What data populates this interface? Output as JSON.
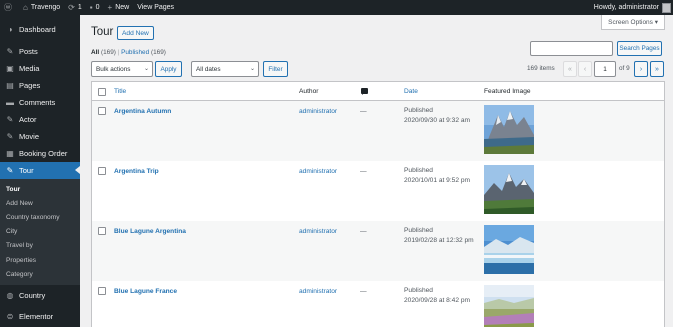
{
  "adminbar": {
    "site_name": "Travengo",
    "updates_count": "1",
    "comments_count": "0",
    "new_label": "New",
    "view_label": "View Pages",
    "howdy": "Howdy, administrator"
  },
  "sidebar": {
    "items": [
      {
        "label": "Dashboard",
        "icon": "dashboard-icon"
      },
      {
        "label": "Posts",
        "icon": "pin-icon"
      },
      {
        "label": "Media",
        "icon": "media-icon"
      },
      {
        "label": "Pages",
        "icon": "pages-icon"
      },
      {
        "label": "Comments",
        "icon": "comments-icon"
      },
      {
        "label": "Actor",
        "icon": "pin-icon"
      },
      {
        "label": "Movie",
        "icon": "pin-icon"
      },
      {
        "label": "Booking Order",
        "icon": "cart-icon"
      },
      {
        "label": "Tour",
        "icon": "pin-icon"
      }
    ],
    "submenu": [
      "Tour",
      "Add New",
      "Country taxonomy",
      "City",
      "Travel by",
      "Properties",
      "Category"
    ],
    "bottom": [
      {
        "label": "Country",
        "icon": "globe-icon"
      },
      {
        "label": "Elementor",
        "icon": "elementor-icon"
      }
    ]
  },
  "screen_options": "Screen Options ▾",
  "page": {
    "title": "Tour",
    "add_new": "Add New",
    "filter_all": "All",
    "filter_all_count": "(169)",
    "filter_published": "Published",
    "filter_published_count": "(169)",
    "search_button": "Search Pages"
  },
  "tablenav": {
    "bulk_actions": "Bulk actions",
    "apply": "Apply",
    "dates": "All dates",
    "filter": "Filter",
    "items": "169 items",
    "first": "«",
    "prev": "‹",
    "current_page": "1",
    "of_pages": "of 9",
    "next": "›",
    "last": "»"
  },
  "table": {
    "headers": {
      "title": "Title",
      "author": "Author",
      "date": "Date",
      "image": "Featured Image"
    },
    "rows": [
      {
        "title": "Argentina Autumn",
        "author": "administrator",
        "comments": "—",
        "status": "Published",
        "date": "2020/09/30 at 9:32 am"
      },
      {
        "title": "Argentina Trip",
        "author": "administrator",
        "comments": "—",
        "status": "Published",
        "date": "2020/10/01 at 9:52 pm"
      },
      {
        "title": "Blue Lagune Argentina",
        "author": "administrator",
        "comments": "—",
        "status": "Published",
        "date": "2019/02/28 at 12:32 pm"
      },
      {
        "title": "Blue Lagune France",
        "author": "administrator",
        "comments": "—",
        "status": "Published",
        "date": "2020/09/28 at 8:42 pm"
      }
    ]
  },
  "colors": {
    "accent": "#2271b1",
    "sidebar_bg": "#1d2327",
    "page_bg": "#f0f0f1"
  }
}
